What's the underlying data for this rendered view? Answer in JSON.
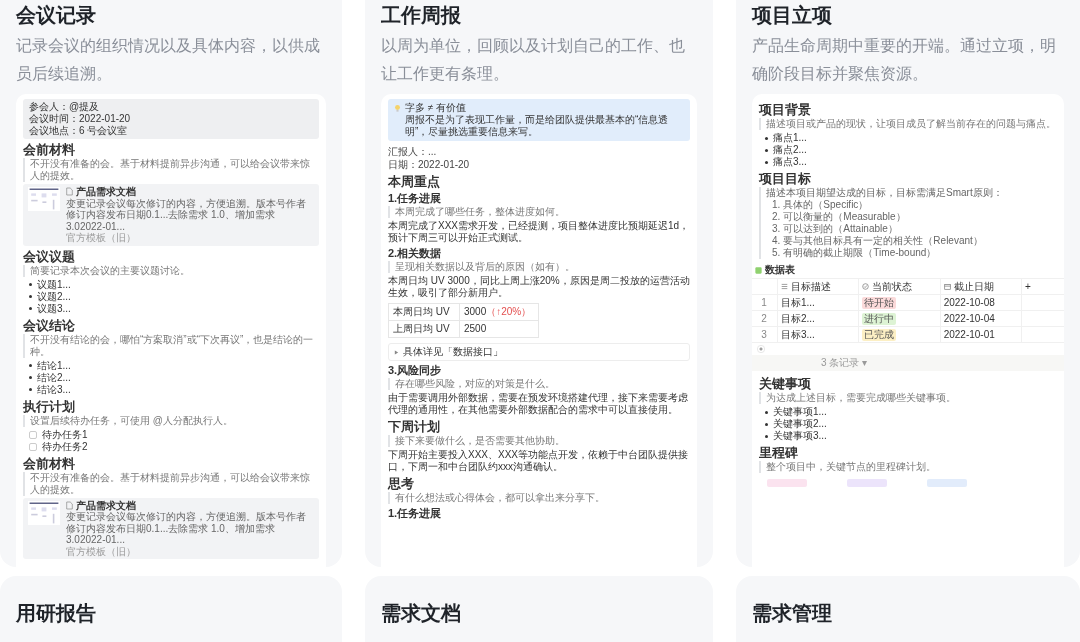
{
  "cards": [
    {
      "title": "会议记录",
      "description": "记录会议的组织情况以及具体内容，以供成员后续追溯。",
      "preview": [
        {
          "kind": "meta",
          "lines": [
            "参会人：@提及",
            "会议时间：2022-01-20",
            "会议地点：6 号会议室"
          ]
        },
        {
          "kind": "h1",
          "text": "会前材料"
        },
        {
          "kind": "quote",
          "text": "不开没有准备的会。基于材料提前异步沟通，可以给会议带来惊人的提效。"
        },
        {
          "kind": "doc",
          "title": "产品需求文档",
          "summary": "变更记录会议每次修订的内容，方便追溯。版本号作者修订内容发布日期0.1...去除需求 1.0、增加需求 3.02022-01...",
          "source": "官方模板（旧）"
        },
        {
          "kind": "h1",
          "text": "会议议题"
        },
        {
          "kind": "quote",
          "text": "简要记录本次会议的主要议题讨论。"
        },
        {
          "kind": "bullets",
          "items": [
            "议题1...",
            "议题2...",
            "议题3..."
          ]
        },
        {
          "kind": "h1",
          "text": "会议结论"
        },
        {
          "kind": "quote",
          "text": "不开没有结论的会，哪怕“方案取消”或“下次再议”，也是结论的一种。"
        },
        {
          "kind": "bullets",
          "items": [
            "结论1...",
            "结论2...",
            "结论3..."
          ]
        },
        {
          "kind": "h1",
          "text": "执行计划"
        },
        {
          "kind": "quote",
          "text": "设置后续待办任务，可使用 @人分配执行人。"
        },
        {
          "kind": "todos",
          "items": [
            {
              "text": "待办任务1",
              "checked": false
            },
            {
              "text": "待办任务2",
              "checked": false
            }
          ]
        },
        {
          "kind": "h1",
          "text": "会前材料"
        },
        {
          "kind": "quote",
          "text": "不开没有准备的会。基于材料提前异步沟通，可以给会议带来惊人的提效。"
        },
        {
          "kind": "doc",
          "title": "产品需求文档",
          "summary": "变更记录会议每次修订的内容，方便追溯。版本号作者修订内容发布日期0.1...去除需求 1.0、增加需求 3.02022-01...",
          "source": "官方模板（旧）"
        }
      ]
    },
    {
      "title": "工作周报",
      "description": "以周为单位，回顾以及计划自己的工作、也让工作更有条理。",
      "preview": [
        {
          "kind": "callout",
          "title": "字多 ≠ 有价值",
          "text": "周报不是为了表现工作量，而是给团队提供最基本的“信息透明”，尽量挑选重要信息来写。"
        },
        {
          "kind": "meta_plain",
          "lines": [
            "汇报人：...",
            "日期：2022-01-20"
          ]
        },
        {
          "kind": "h1",
          "text": "本周重点"
        },
        {
          "kind": "h2",
          "text": "1.任务进展"
        },
        {
          "kind": "quote",
          "text": "本周完成了哪些任务，整体进度如何。"
        },
        {
          "kind": "text",
          "text": "本周完成了XXX需求开发，已经提测，项目整体进度比预期延迟1d，预计下周三可以开始正式测试。"
        },
        {
          "kind": "h2",
          "text": "2.相关数据"
        },
        {
          "kind": "quote",
          "text": "呈现相关数据以及背后的原因（如有）。"
        },
        {
          "kind": "text",
          "text": "本周日均 UV 3000，同比上周上涨20%，原因是周二投放的运营活动生效，吸引了部分新用户。"
        },
        {
          "kind": "kv_table",
          "rows": [
            {
              "label": "本周日均 UV",
              "value": "3000",
              "change": "（↑20%）"
            },
            {
              "label": "上周日均 UV",
              "value": "2500"
            }
          ]
        },
        {
          "kind": "toggle",
          "text": "具体详见「数据接口」"
        },
        {
          "kind": "h2",
          "text": "3.风险同步"
        },
        {
          "kind": "quote",
          "text": "存在哪些风险，对应的对策是什么。"
        },
        {
          "kind": "text",
          "text": "由于需要调用外部数据，需要在预发环境搭建代理，接下来需要考虑代理的通用性，在其他需要外部数据配合的需求中可以直接使用。"
        },
        {
          "kind": "h1",
          "text": "下周计划"
        },
        {
          "kind": "quote",
          "text": "接下来要做什么，是否需要其他协助。"
        },
        {
          "kind": "text",
          "text": "下周开始主要投入XXX、XXX等功能点开发，依赖于中台团队提供接口，下周一和中台团队约xxx沟通确认。"
        },
        {
          "kind": "h1",
          "text": "思考"
        },
        {
          "kind": "quote",
          "text": "有什么想法或心得体会，都可以拿出来分享下。"
        },
        {
          "kind": "h2",
          "text": "1.任务进展"
        }
      ]
    },
    {
      "title": "项目立项",
      "description": "产品生命周期中重要的开端。通过立项，明确阶段目标并聚焦资源。",
      "preview": [
        {
          "kind": "h1",
          "text": "项目背景"
        },
        {
          "kind": "quote",
          "text": "描述项目或产品的现状，让项目成员了解当前存在的问题与痛点。"
        },
        {
          "kind": "bullets",
          "items": [
            "痛点1...",
            "痛点2...",
            "痛点3..."
          ]
        },
        {
          "kind": "h1",
          "text": "项目目标"
        },
        {
          "kind": "ordered",
          "text": "描述本项目期望达成的目标，目标需满足Smart原则：",
          "items": [
            {
              "no": "1.",
              "text": "具体的（Specific）"
            },
            {
              "no": "2.",
              "text": "可以衡量的（Measurable）"
            },
            {
              "no": "3.",
              "text": "可以达到的（Attainable）"
            },
            {
              "no": "4.",
              "text": "要与其他目标具有一定的相关性（Relevant）"
            },
            {
              "no": "5.",
              "text": "有明确的截止期限（Time-bound）"
            }
          ]
        },
        {
          "kind": "datatable",
          "title": "数据表",
          "columns": [
            "目标描述",
            "当前状态",
            "截止日期",
            "+"
          ],
          "rows": [
            {
              "no": "1",
              "goal": "目标1...",
              "status": "待开始",
              "color": "#fbdada",
              "date": "2022-10-08"
            },
            {
              "no": "2",
              "goal": "目标2...",
              "status": "进行中",
              "color": "#ddf3d4",
              "date": "2022-10-04"
            },
            {
              "no": "3",
              "goal": "目标3...",
              "status": "已完成",
              "color": "#fcefc4",
              "date": "2022-10-01"
            }
          ],
          "footer": "3 条记录 ▾"
        },
        {
          "kind": "h1",
          "text": "关键事项"
        },
        {
          "kind": "quote",
          "text": "为达成上述目标，需要完成哪些关键事项。"
        },
        {
          "kind": "bullets",
          "items": [
            "关键事项1...",
            "关键事项2...",
            "关键事项3..."
          ]
        },
        {
          "kind": "h1",
          "text": "里程碑"
        },
        {
          "kind": "quote",
          "text": "整个项目中，关键节点的里程碑计划。"
        },
        {
          "kind": "milestones",
          "items": [
            {
              "color": "#fbe3ef"
            },
            {
              "color": "#ece4fb"
            },
            {
              "color": "#e2ecfb"
            }
          ]
        }
      ]
    }
  ],
  "more_cards": [
    {
      "title": "用研报告"
    },
    {
      "title": "需求文档"
    },
    {
      "title": "需求管理"
    }
  ]
}
